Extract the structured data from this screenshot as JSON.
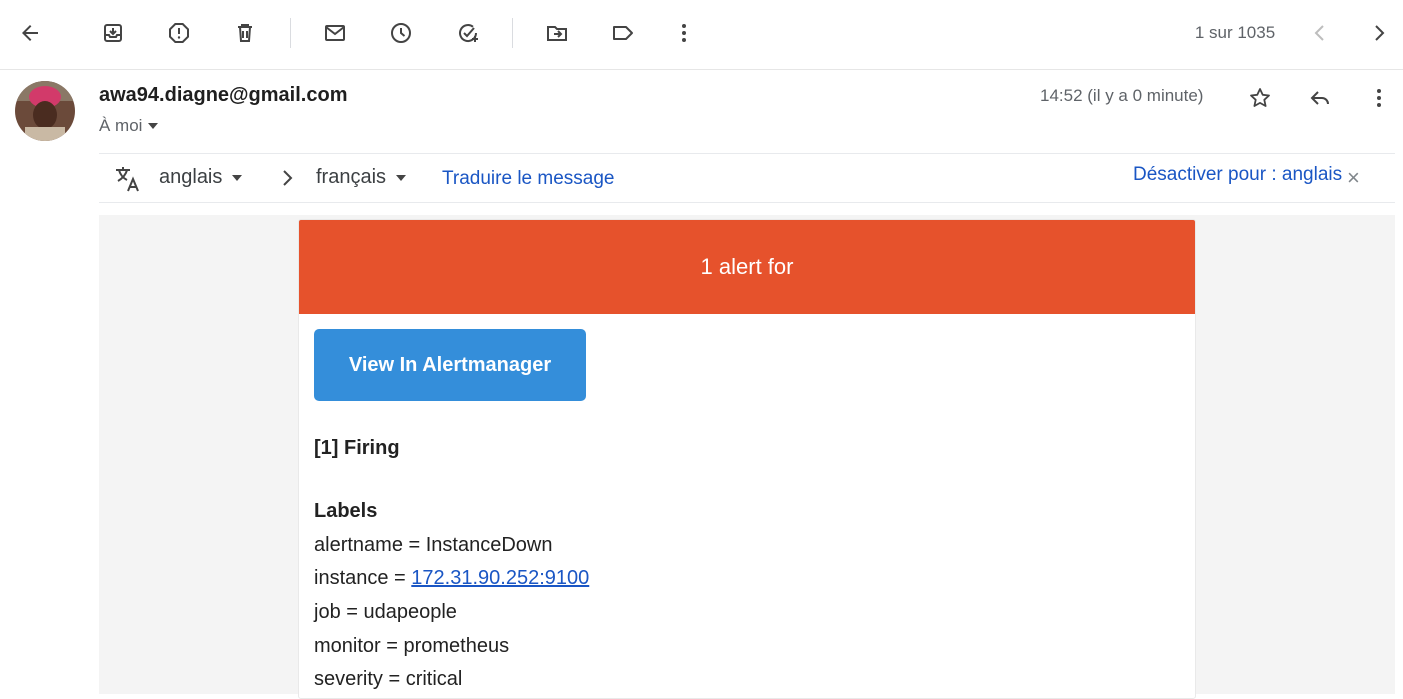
{
  "toolbar": {
    "icons": [
      "back-arrow-icon",
      "archive-icon",
      "report-spam-icon",
      "delete-icon",
      "mark-unread-icon",
      "snooze-icon",
      "add-task-icon",
      "move-to-icon",
      "label-icon",
      "more-vert-icon"
    ],
    "pager": "1 sur 1035"
  },
  "message": {
    "sender": "awa94.diagne@gmail.com",
    "recipient": "À moi",
    "time": "14:52 (il y a 0 minute)"
  },
  "translation": {
    "source_lang": "anglais",
    "target_lang": "français",
    "translate_link": "Traduire le message",
    "disable_link": "Désactiver pour : anglais",
    "close": "×"
  },
  "email": {
    "header": "1 alert for",
    "button": "View In Alertmanager",
    "firing": "[1] Firing",
    "labels_title": "Labels",
    "labels": [
      {
        "text": "alertname = InstanceDown"
      },
      {
        "prefix": "instance = ",
        "link": "172.31.90.252:9100"
      },
      {
        "text": "job = udapeople"
      },
      {
        "text": "monitor = prometheus"
      },
      {
        "text": "severity = critical"
      }
    ]
  },
  "colors": {
    "alert_header": "#e6522c",
    "button": "#348eda",
    "link": "#1a56c4"
  }
}
